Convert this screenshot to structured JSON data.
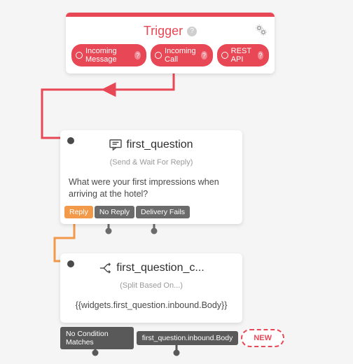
{
  "colors": {
    "accent": "#e84855",
    "orange": "#f2994a",
    "gray_tab": "#6b6b6b",
    "gray_tab_dark": "#595959"
  },
  "trigger": {
    "title": "Trigger",
    "pills": [
      {
        "label": "Incoming Message"
      },
      {
        "label": "Incoming Call"
      },
      {
        "label": "REST API"
      }
    ]
  },
  "widget1": {
    "icon": "speech-bubble",
    "title": "first_question",
    "subtitle": "(Send & Wait For Reply)",
    "body": "What were your first impressions when arriving at the hotel?",
    "tabs": [
      {
        "label": "Reply",
        "variant": "orange"
      },
      {
        "label": "No Reply",
        "variant": "gray"
      },
      {
        "label": "Delivery Fails",
        "variant": "gray"
      }
    ]
  },
  "widget2": {
    "icon": "split",
    "title": "first_question_c...",
    "subtitle": "(Split Based On...)",
    "body": "{{widgets.first_question.inbound.Body}}",
    "tabs": [
      {
        "label": "No Condition Matches"
      },
      {
        "label": "first_question.inbound.Body"
      }
    ],
    "new_label": "NEW"
  }
}
